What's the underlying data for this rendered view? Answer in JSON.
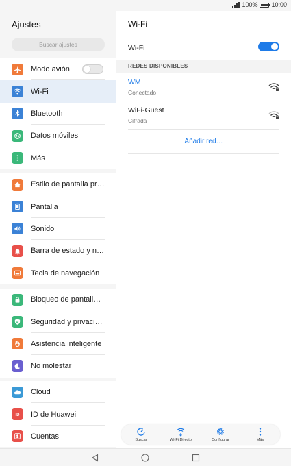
{
  "status_bar": {
    "battery": "100%",
    "time": "10:00"
  },
  "left_panel": {
    "title": "Ajustes",
    "search_placeholder": "Buscar ajustes",
    "groups": [
      [
        {
          "label": "Modo avión",
          "icon": "airplane-icon",
          "color": "#f07a3a",
          "toggle": "off"
        },
        {
          "label": "Wi-Fi",
          "icon": "wifi-icon",
          "color": "#3b82d6",
          "active": true
        },
        {
          "label": "Bluetooth",
          "icon": "bluetooth-icon",
          "color": "#3b82d6"
        },
        {
          "label": "Datos móviles",
          "icon": "mobile-data-icon",
          "color": "#3bb87a"
        },
        {
          "label": "Más",
          "icon": "more-icon",
          "color": "#3bb87a"
        }
      ],
      [
        {
          "label": "Estilo de pantalla principal",
          "icon": "home-icon",
          "color": "#f07a3a"
        },
        {
          "label": "Pantalla",
          "icon": "display-icon",
          "color": "#3b82d6"
        },
        {
          "label": "Sonido",
          "icon": "sound-icon",
          "color": "#3b82d6"
        },
        {
          "label": "Barra de estado y notificaciones",
          "icon": "bell-icon",
          "color": "#e8504a"
        },
        {
          "label": "Tecla de navegación",
          "icon": "nav-key-icon",
          "color": "#f07a3a"
        }
      ],
      [
        {
          "label": "Bloqueo de pantalla y contraseñas",
          "icon": "lock-icon",
          "color": "#3bb87a"
        },
        {
          "label": "Seguridad y privacidad",
          "icon": "shield-icon",
          "color": "#3bb87a"
        },
        {
          "label": "Asistencia inteligente",
          "icon": "hand-icon",
          "color": "#f07a3a"
        },
        {
          "label": "No molestar",
          "icon": "moon-icon",
          "color": "#6a5fd0"
        }
      ],
      [
        {
          "label": "Cloud",
          "icon": "cloud-icon",
          "color": "#3b9ad6"
        },
        {
          "label": "ID de Huawei",
          "icon": "id-icon",
          "color": "#e8504a"
        },
        {
          "label": "Cuentas",
          "icon": "account-icon",
          "color": "#e8504a"
        }
      ]
    ]
  },
  "right_panel": {
    "title": "Wi-Fi",
    "wifi_toggle_label": "Wi-Fi",
    "wifi_enabled": true,
    "section_header": "REDES DISPONIBLES",
    "networks": [
      {
        "name": "WM",
        "status": "Conectado",
        "connected": true
      },
      {
        "name": "WiFi-Guest",
        "status": "Cifrada",
        "connected": false
      }
    ],
    "add_network": "Añadir red…"
  },
  "bottom_toolbar": [
    {
      "label": "Buscar",
      "icon": "refresh-search-icon"
    },
    {
      "label": "Wi-Fi Directo",
      "icon": "wifi-direct-icon"
    },
    {
      "label": "Configurar",
      "icon": "settings-gear-icon"
    },
    {
      "label": "Más",
      "icon": "more-vertical-icon"
    }
  ],
  "colors": {
    "accent": "#1e7be8",
    "active_row": "#e6eef8"
  }
}
